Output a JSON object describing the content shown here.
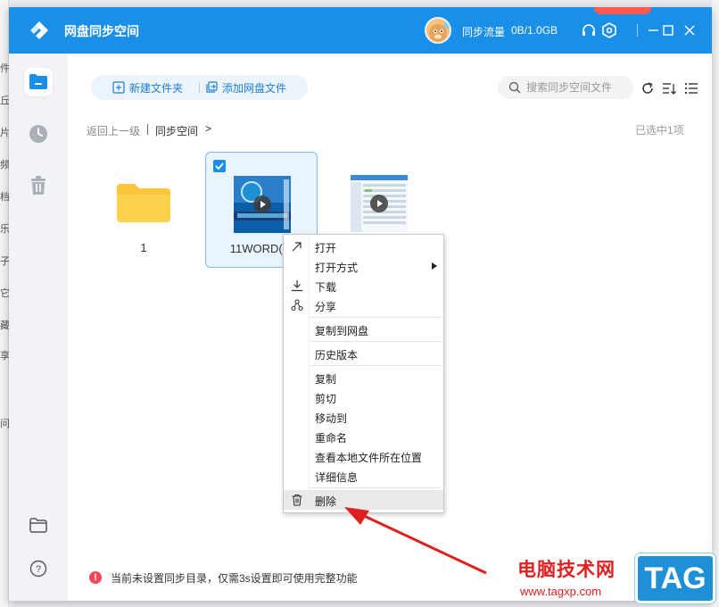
{
  "window": {
    "app_title": "网盘同步空间",
    "sync_label": "同步流量",
    "sync_value": "0B/1.0GB"
  },
  "toolbar": {
    "new_folder": "新建文件夹",
    "add_cloud_file": "添加网盘文件",
    "search_placeholder": "搜索同步空间文件"
  },
  "breadcrumb": {
    "back": "返回上一级",
    "current": "同步空间",
    "arrow": ">",
    "selected_count": "已选中1项"
  },
  "files": [
    {
      "name": "1",
      "type": "folder"
    },
    {
      "name": "11WORD(1)",
      "type": "video",
      "selected": true
    },
    {
      "name": "",
      "type": "video"
    }
  ],
  "context_menu": {
    "items": [
      {
        "label": "打开",
        "icon": "open-arrow-icon"
      },
      {
        "label": "打开方式",
        "icon": "",
        "submenu": true
      },
      {
        "label": "下载",
        "icon": "download-icon"
      },
      {
        "label": "分享",
        "icon": "share-icon"
      },
      {
        "label": "复制到网盘",
        "icon": ""
      },
      {
        "label": "历史版本",
        "icon": ""
      },
      {
        "label": "复制",
        "icon": ""
      },
      {
        "label": "剪切",
        "icon": ""
      },
      {
        "label": "移动到",
        "icon": ""
      },
      {
        "label": "重命名",
        "icon": ""
      },
      {
        "label": "查看本地文件所在位置",
        "icon": ""
      },
      {
        "label": "详细信息",
        "icon": ""
      },
      {
        "label": "删除",
        "icon": "trash-icon",
        "highlighted": true
      }
    ]
  },
  "notice": {
    "icon_text": "!",
    "text": "当前未设置同步目录，仅需3s设置即可使用完整功能"
  },
  "watermark": {
    "site_name": "电脑技术网",
    "url": "www.tagxp.com",
    "tag": "TAG"
  },
  "background_app": {
    "glyphs": [
      "件",
      "丘",
      "片",
      "频",
      "档",
      "乐",
      "子",
      "它",
      "藏",
      "享",
      "问"
    ]
  },
  "colors": {
    "accent": "#1a8fe8",
    "titlebar": "#1a8fe8",
    "folder": "#fcc63a",
    "notice_icon": "#f0475b",
    "annotation_arrow": "#e02020"
  }
}
